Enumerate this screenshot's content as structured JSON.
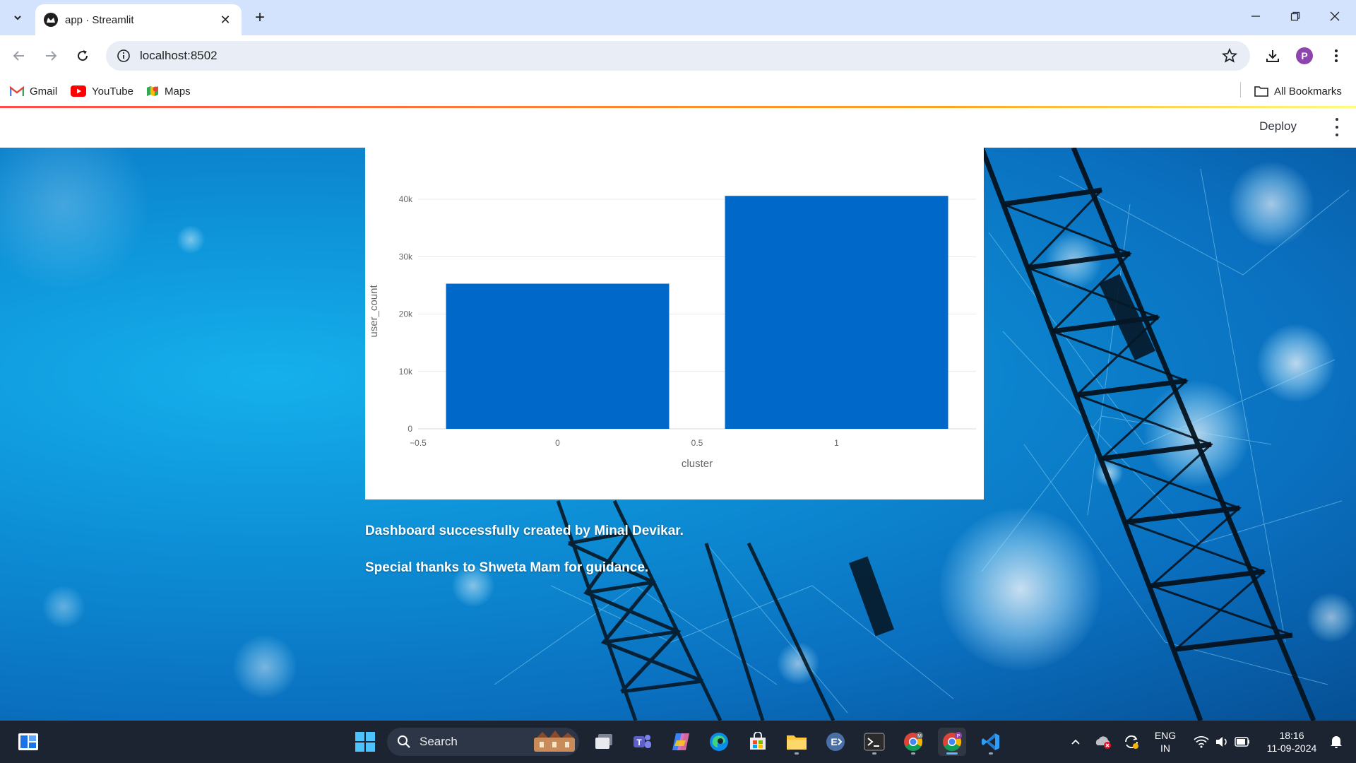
{
  "browser": {
    "tab_title": "app · Streamlit",
    "url": "localhost:8502",
    "profile_initial": "P",
    "bookmarks": [
      {
        "label": "Gmail",
        "icon": "gmail-icon"
      },
      {
        "label": "YouTube",
        "icon": "youtube-icon"
      },
      {
        "label": "Maps",
        "icon": "maps-icon"
      }
    ],
    "all_bookmarks": "All Bookmarks"
  },
  "streamlit": {
    "deploy_label": "Deploy",
    "accent_gradient": [
      "#ff4b4b",
      "#ffa421",
      "#fffd80"
    ]
  },
  "chart_data": {
    "type": "bar",
    "x": [
      0,
      1
    ],
    "values": [
      25300,
      40600
    ],
    "xlabel": "cluster",
    "ylabel": "user_count",
    "xlim": [
      -0.5,
      1.5
    ],
    "ylim": [
      0,
      41000
    ],
    "xticks": [
      -0.5,
      0,
      0.5,
      1
    ],
    "xtick_labels": [
      "−0.5",
      "0",
      "0.5",
      "1"
    ],
    "yticks": [
      0,
      10000,
      20000,
      30000,
      40000
    ],
    "ytick_labels": [
      "0",
      "10k",
      "20k",
      "30k",
      "40k"
    ],
    "bar_color": "#0068c9",
    "grid": true
  },
  "page": {
    "credit_line": "Dashboard successfully created by Minal Devikar.",
    "thanks_line": "Special thanks to Shweta Mam for guidance."
  },
  "taskbar": {
    "search_label": "Search",
    "language": "ENG",
    "region": "IN",
    "time": "18:16",
    "date": "11-09-2024"
  }
}
